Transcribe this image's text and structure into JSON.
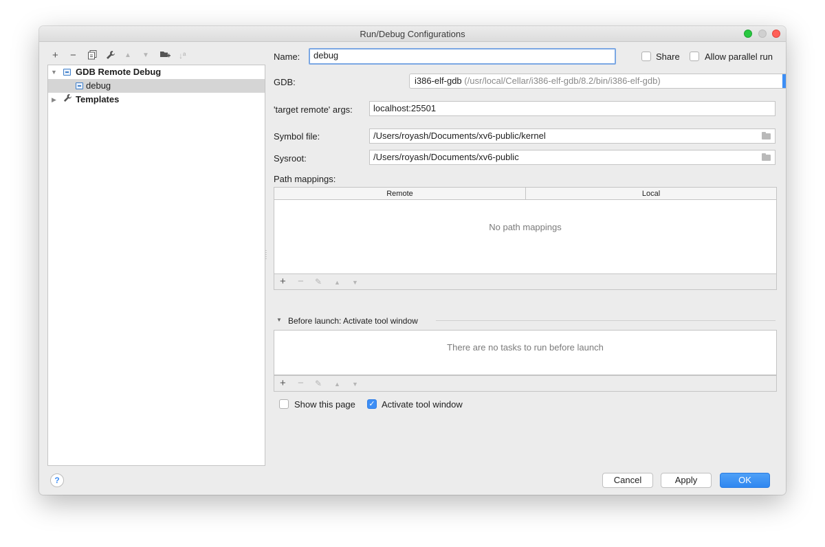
{
  "window": {
    "title": "Run/Debug Configurations"
  },
  "left_toolbar": {
    "add": "+",
    "remove": "−",
    "copy_icon": "copy-icon",
    "edit_defaults_icon": "wrench-icon",
    "move_up": "▲",
    "move_down": "▼",
    "new_folder_icon": "folder-add-icon",
    "sort": "↓ª"
  },
  "tree": {
    "groups": [
      {
        "label": "GDB Remote Debug",
        "expanded": true,
        "children": [
          {
            "label": "debug",
            "selected": true
          }
        ]
      },
      {
        "label": "Templates",
        "expanded": false,
        "children": []
      }
    ]
  },
  "form": {
    "name_label": "Name:",
    "name_value": "debug",
    "share_label": "Share",
    "share_checked": false,
    "parallel_label": "Allow parallel run",
    "parallel_checked": false,
    "gdb_label": "GDB:",
    "gdb_value": "i386-elf-gdb",
    "gdb_path": "(/usr/local/Cellar/i386-elf-gdb/8.2/bin/i386-elf-gdb)",
    "gdb_more": "...",
    "target_label": "'target remote' args:",
    "target_value": "localhost:25501",
    "symbol_label": "Symbol file:",
    "symbol_value": "/Users/royash/Documents/xv6-public/kernel",
    "sysroot_label": "Sysroot:",
    "sysroot_value": "/Users/royash/Documents/xv6-public",
    "path_mappings_label": "Path mappings:",
    "path_mappings": {
      "columns": [
        "Remote",
        "Local"
      ],
      "empty_text": "No path mappings",
      "toolbar": {
        "add": "+",
        "remove": "−",
        "edit": "✎",
        "up": "▲",
        "down": "▼"
      }
    },
    "before_launch": {
      "title": "Before launch: Activate tool window",
      "empty_text": "There are no tasks to run before launch",
      "toolbar": {
        "add": "+",
        "remove": "−",
        "edit": "✎",
        "up": "▲",
        "down": "▼"
      }
    },
    "show_page_label": "Show this page",
    "show_page_checked": false,
    "activate_label": "Activate tool window",
    "activate_checked": true
  },
  "footer": {
    "help": "?",
    "cancel": "Cancel",
    "apply": "Apply",
    "ok": "OK"
  },
  "colors": {
    "accent": "#3d8ef5",
    "focus_ring": "#7ba7e3",
    "window_bg": "#ececec"
  }
}
